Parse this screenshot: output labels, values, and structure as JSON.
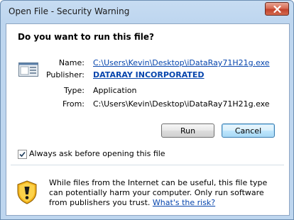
{
  "window": {
    "title": "Open File - Security Warning"
  },
  "dialog": {
    "question": "Do you want to run this file?",
    "fields": [
      {
        "label": "Name:",
        "value": "C:\\Users\\Kevin\\Desktop\\iDataRay71H21g.exe"
      },
      {
        "label": "Publisher:",
        "value": "DATARAY INCORPORATED"
      },
      {
        "label": "Type:",
        "value": "Application"
      },
      {
        "label": "From:",
        "value": "C:\\Users\\Kevin\\Desktop\\iDataRay71H21g.exe"
      }
    ],
    "buttons": {
      "run": "Run",
      "cancel": "Cancel"
    },
    "checkbox": {
      "label": "Always ask before opening this file",
      "checked": true
    },
    "warning": {
      "text": "While files from the Internet can be useful, this file type can potentially harm your computer. Only run software from publishers you trust. ",
      "link": "What's the risk?"
    }
  },
  "icons": {
    "close": "close-icon",
    "file": "file-icon",
    "shield": "shield-warning-icon"
  },
  "colors": {
    "link": "#0645ad",
    "title_bar": "#bed6ef",
    "close_button": "#c2432c"
  }
}
